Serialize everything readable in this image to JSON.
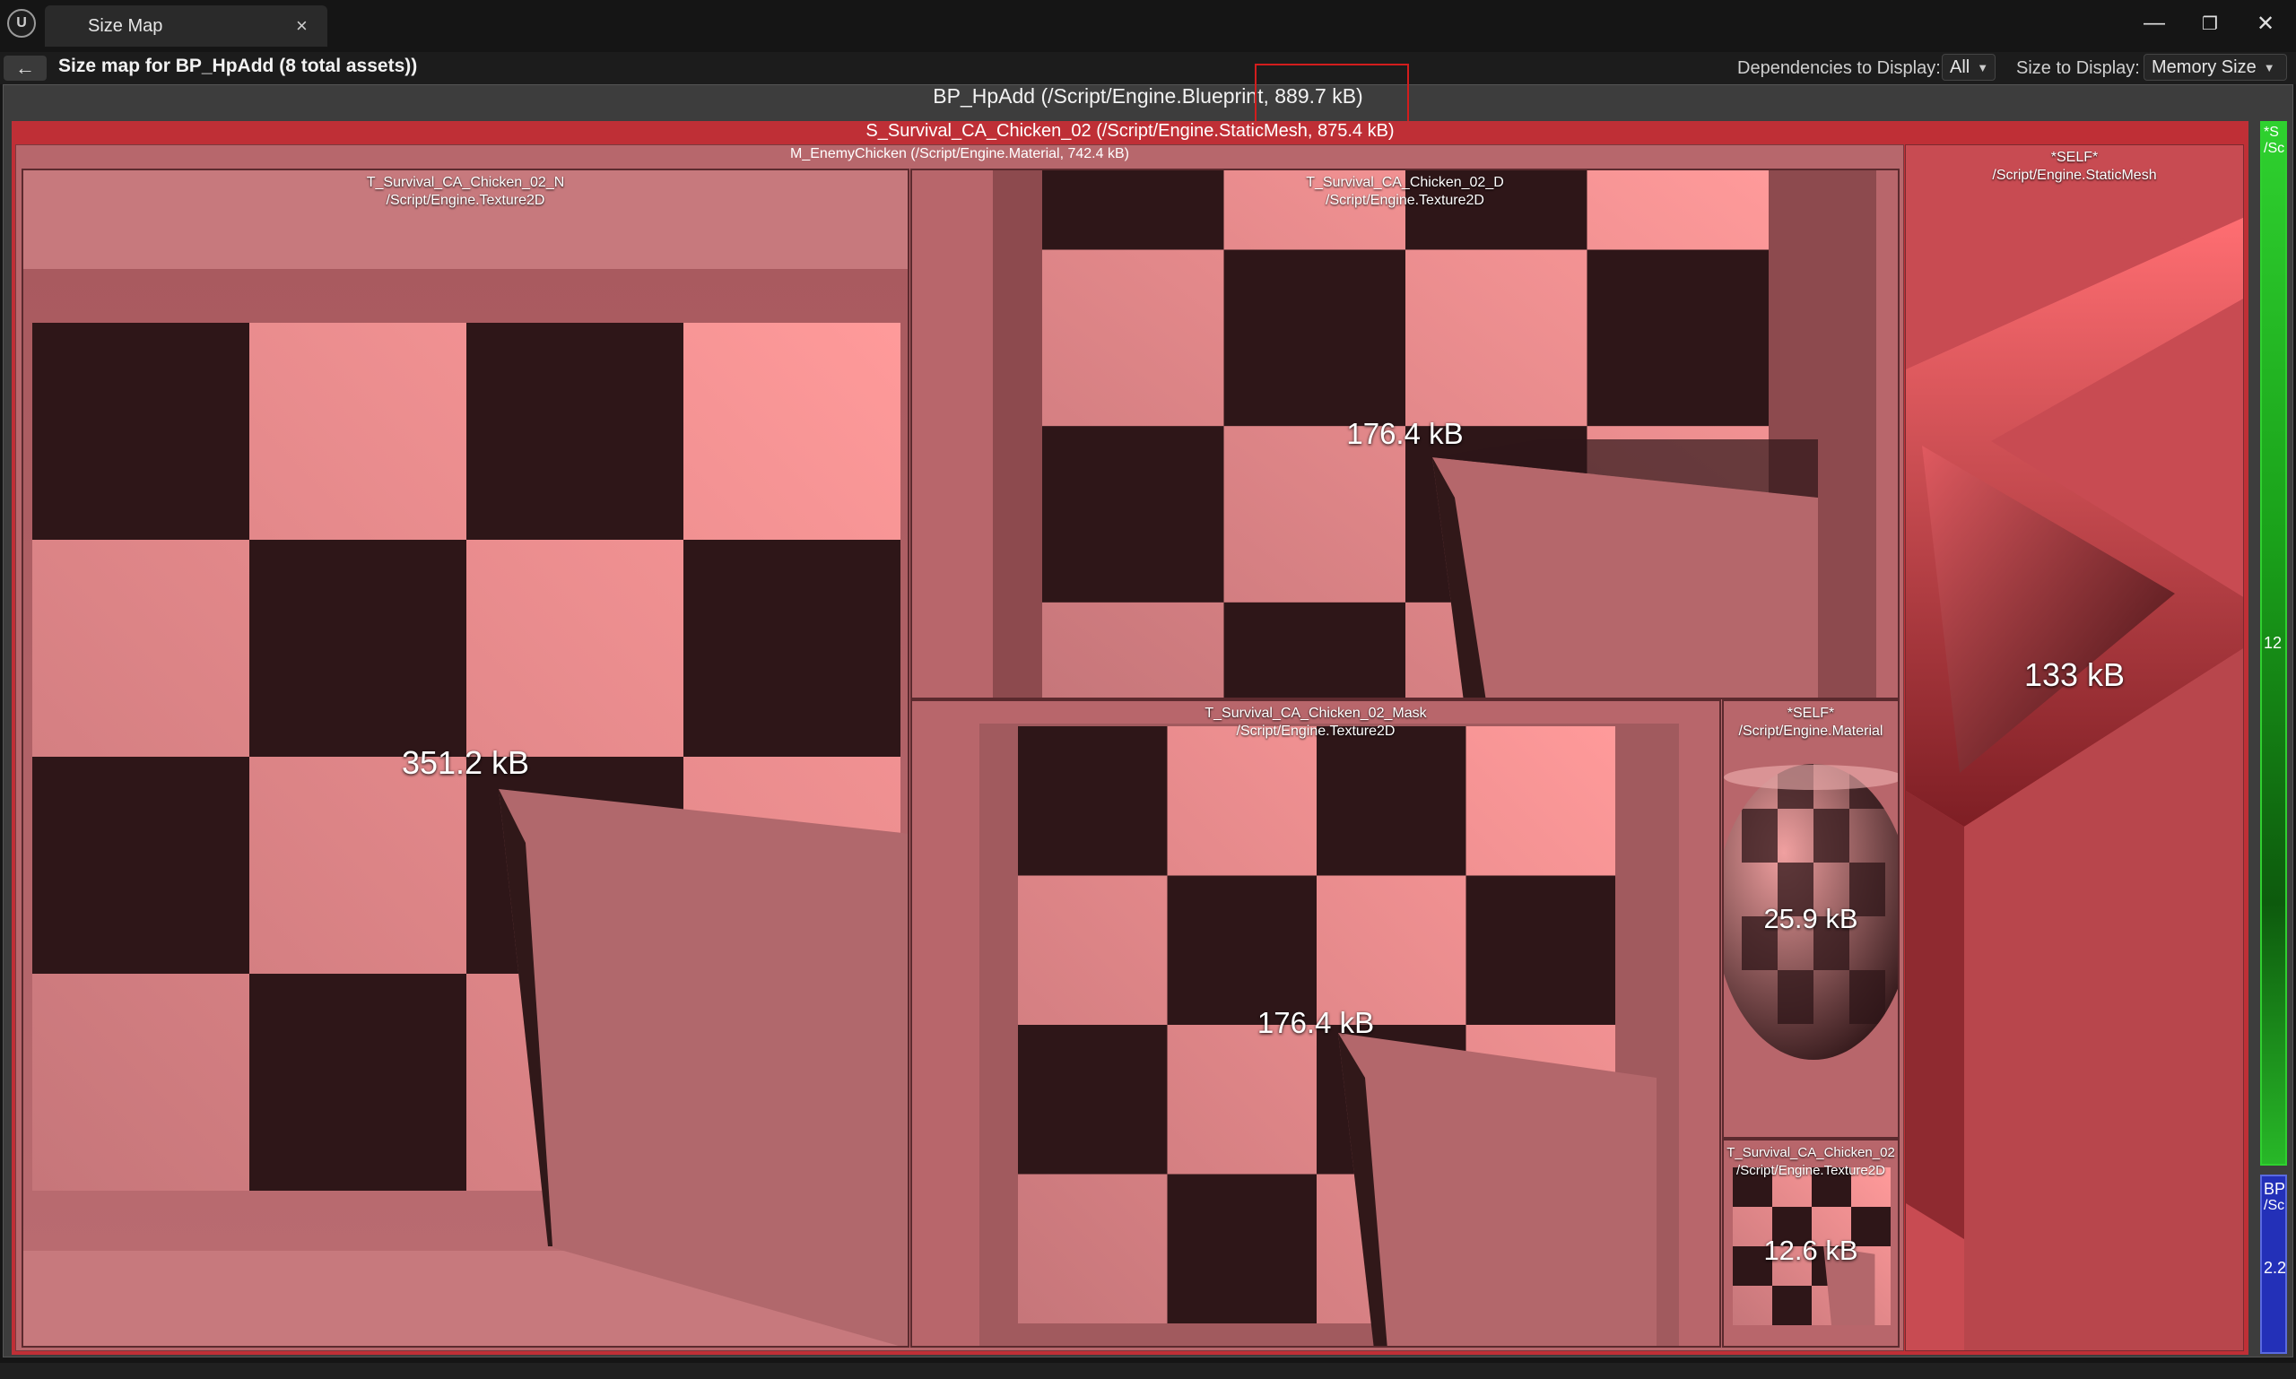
{
  "window": {
    "tab_title": "Size Map",
    "tab_close": "×",
    "controls": {
      "minimize": "—",
      "restore": "❐",
      "close": "✕"
    }
  },
  "toolbar": {
    "back_icon": "←",
    "heading": "Size map for BP_HpAdd  (8 total assets))",
    "dependencies_label": "Dependencies to Display:",
    "dependencies_value": "All",
    "size_label": "Size to Display:",
    "size_value": "Memory Size"
  },
  "root": {
    "label": "BP_HpAdd  (/Script/Engine.Blueprint, 889.7 kB)"
  },
  "static_mesh": {
    "label": "S_Survival_CA_Chicken_02  (/Script/Engine.StaticMesh, 875.4 kB)"
  },
  "material": {
    "label": "M_EnemyChicken  (/Script/Engine.Material, 742.4 kB)"
  },
  "tiles": {
    "tex_n": {
      "name": "T_Survival_CA_Chicken_02_N",
      "type": "/Script/Engine.Texture2D",
      "size": "351.2 kB"
    },
    "tex_d": {
      "name": "T_Survival_CA_Chicken_02_D",
      "type": "/Script/Engine.Texture2D",
      "size": "176.4 kB"
    },
    "tex_mask": {
      "name": "T_Survival_CA_Chicken_02_Mask",
      "type": "/Script/Engine.Texture2D",
      "size": "176.4 kB"
    },
    "self_material": {
      "name": "*SELF*",
      "type": "/Script/Engine.Material",
      "size": "25.9 kB"
    },
    "tex_small": {
      "name": "T_Survival_CA_Chicken_02",
      "type": "/Script/Engine.Texture2D",
      "size": "12.6 kB"
    },
    "self_mesh": {
      "name": "*SELF*",
      "type": "/Script/Engine.StaticMesh",
      "size": "133 kB"
    }
  },
  "side_strips": {
    "green": {
      "line1": "*S",
      "line2": "/Sc",
      "value": "12"
    },
    "blue": {
      "line1": "BP",
      "line2": "/Sc",
      "value": "2.2"
    }
  },
  "colors": {
    "highlight": "#d21d1d",
    "mesh": "#bf2f36",
    "material": "#b7676c",
    "checker_dark": "#2e1618",
    "checker_light": "#d98083",
    "green_strip": "#1a8a1a",
    "blue_strip": "#2330b8"
  }
}
